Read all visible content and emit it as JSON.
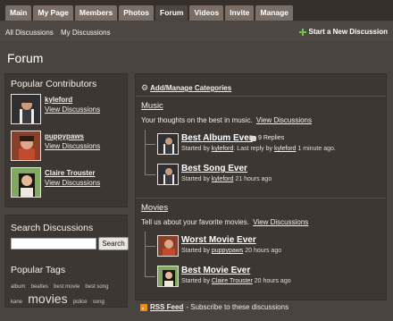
{
  "nav": {
    "tabs": [
      {
        "label": "Main"
      },
      {
        "label": "My Page"
      },
      {
        "label": "Members"
      },
      {
        "label": "Photos"
      },
      {
        "label": "Forum",
        "active": true
      },
      {
        "label": "Videos"
      },
      {
        "label": "Invite"
      },
      {
        "label": "Manage"
      }
    ]
  },
  "subnav": {
    "all_discussions": "All Discussions",
    "my_discussions": "My Discussions",
    "start_new": "Start a New Discussion"
  },
  "page_title": "Forum",
  "contributors": {
    "title": "Popular Contributors",
    "items": [
      {
        "name": "kyleford",
        "link": "View Discussions"
      },
      {
        "name": "puppypaws",
        "link": "View Discussions"
      },
      {
        "name": "Claire Trouster",
        "link": "View Discussions"
      }
    ]
  },
  "search": {
    "title": "Search Discussions",
    "button": "Search",
    "value": ""
  },
  "tags": {
    "title": "Popular Tags",
    "list": [
      "album",
      "beatles",
      "best movie",
      "best song",
      "kane",
      "movies",
      "police",
      "song"
    ]
  },
  "main": {
    "manage_categories": "Add/Manage Categories",
    "categories": [
      {
        "title": "Music",
        "description": "Your thoughts on the best in music.",
        "view_link": "View Discussions",
        "threads": [
          {
            "title": "Best Album Ever",
            "replies": "9 Replies",
            "started_by": "Started by",
            "author": "kyleford",
            "last_reply": "Last reply by",
            "last_reply_author": "kyleford",
            "time": "1 minute ago."
          },
          {
            "title": "Best Song Ever",
            "started_by": "Started by",
            "author": "kyleford",
            "time": "21 hours ago"
          }
        ]
      },
      {
        "title": "Movies",
        "description": "Tell us about your favorite movies.",
        "view_link": "View Discussions",
        "threads": [
          {
            "title": "Worst Movie Ever",
            "started_by": "Started by",
            "author": "puppypaws",
            "time": "20 hours ago"
          },
          {
            "title": "Best Movie Ever",
            "started_by": "Started by",
            "author": "Claire Trouster",
            "time": "20 hours ago"
          }
        ]
      }
    ],
    "rss": {
      "feed": "RSS Feed",
      "text": "- Subscribe to these discussions"
    }
  }
}
